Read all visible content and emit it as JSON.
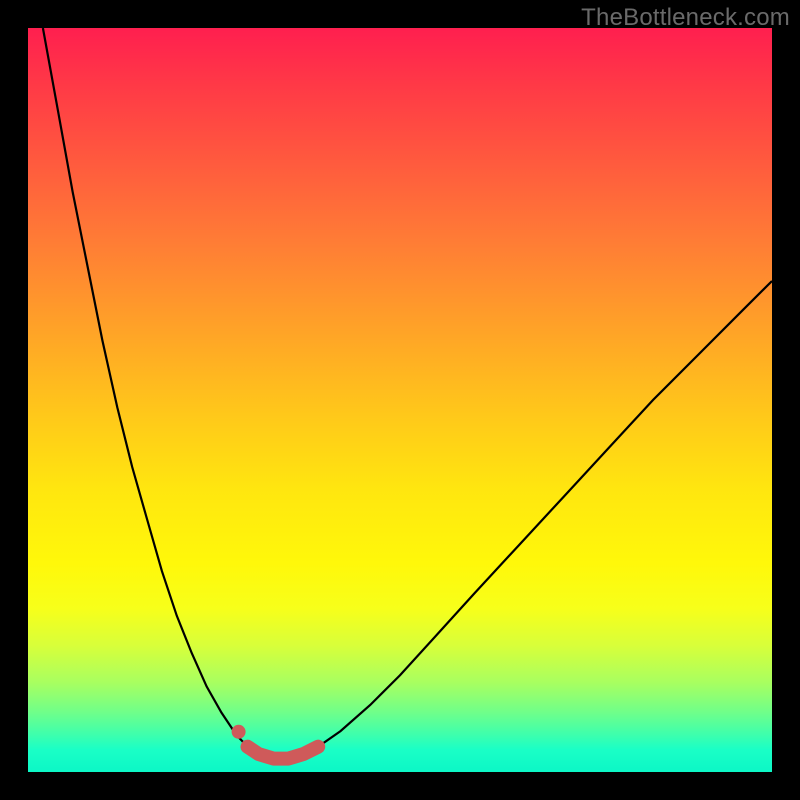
{
  "watermark": "TheBottleneck.com",
  "colors": {
    "page_bg": "#000000",
    "watermark": "#6a6a6a",
    "curve": "#000000",
    "marker": "#cf5a5a",
    "gradient_top": "#ff1f4f",
    "gradient_mid": "#ffe60f",
    "gradient_bottom": "#0cf7c6"
  },
  "chart_data": {
    "type": "line",
    "title": "",
    "xlabel": "",
    "ylabel": "",
    "xlim": [
      0,
      100
    ],
    "ylim": [
      0,
      100
    ],
    "grid": false,
    "annotations": [],
    "series": [
      {
        "name": "left-branch",
        "x": [
          2,
          4,
          6,
          8,
          10,
          12,
          14,
          16,
          18,
          20,
          22,
          24,
          26,
          28,
          29.5,
          31
        ],
        "y": [
          100,
          89,
          78,
          68,
          58,
          49,
          41,
          34,
          27,
          21,
          16,
          11.5,
          8,
          5,
          3.4,
          2.4
        ]
      },
      {
        "name": "right-branch",
        "x": [
          37,
          39,
          42,
          46,
          50,
          55,
          60,
          66,
          72,
          78,
          84,
          90,
          96,
          100
        ],
        "y": [
          2.4,
          3.4,
          5.5,
          9,
          13,
          18.5,
          24,
          30.5,
          37,
          43.5,
          50,
          56,
          62,
          66
        ]
      },
      {
        "name": "valley-floor",
        "x": [
          31,
          33,
          35,
          37
        ],
        "y": [
          2.4,
          1.8,
          1.8,
          2.4
        ]
      }
    ],
    "highlight": {
      "name": "minimum-region",
      "path_x": [
        29.5,
        31,
        33,
        35,
        37,
        39
      ],
      "path_y": [
        3.4,
        2.4,
        1.8,
        1.8,
        2.4,
        3.4
      ],
      "dot": {
        "x": 28.3,
        "y": 5.4
      }
    }
  }
}
